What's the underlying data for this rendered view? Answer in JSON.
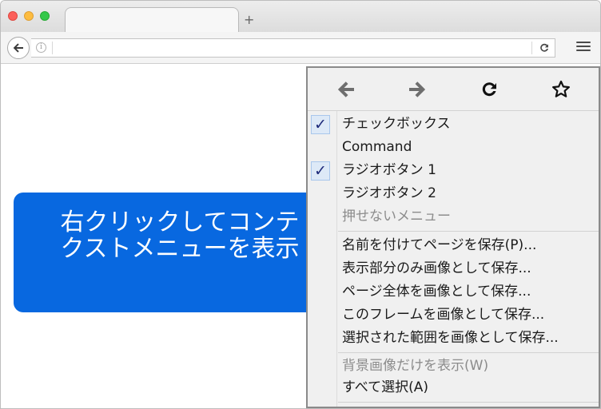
{
  "browser": {
    "tab_title": "",
    "new_tab_label": "+",
    "url": "",
    "info_glyph": "i"
  },
  "page": {
    "button_text": "右クリックしてコンテクストメニューを表示"
  },
  "context_menu": {
    "nav_icons": [
      "back-arrow-icon",
      "forward-arrow-icon",
      "reload-icon",
      "bookmark-star-icon"
    ],
    "items": [
      {
        "label": "チェックボックス",
        "checked": true,
        "disabled": false
      },
      {
        "label": "Command",
        "checked": false,
        "disabled": false
      },
      {
        "label": "ラジオボタン 1",
        "checked": true,
        "disabled": false
      },
      {
        "label": "ラジオボタン 2",
        "checked": false,
        "disabled": false
      },
      {
        "label": "押せないメニュー",
        "checked": false,
        "disabled": true
      },
      {
        "label": "名前を付けてページを保存(P)...",
        "checked": false,
        "disabled": false
      },
      {
        "label": "表示部分のみ画像として保存...",
        "checked": false,
        "disabled": false
      },
      {
        "label": "ページ全体を画像として保存...",
        "checked": false,
        "disabled": false
      },
      {
        "label": "このフレームを画像として保存...",
        "checked": false,
        "disabled": false
      },
      {
        "label": "選択された範囲を画像として保存...",
        "checked": false,
        "disabled": false
      },
      {
        "label": "背景画像だけを表示(W)",
        "checked": false,
        "disabled": true
      },
      {
        "label": "すべて選択(A)",
        "checked": false,
        "disabled": false
      }
    ],
    "check_glyph": "✓"
  },
  "colors": {
    "button_blue": "#0868e0",
    "menu_bg": "#f0f0f0",
    "menu_border": "#8a8a8a",
    "disabled_text": "#8c8c8c"
  }
}
